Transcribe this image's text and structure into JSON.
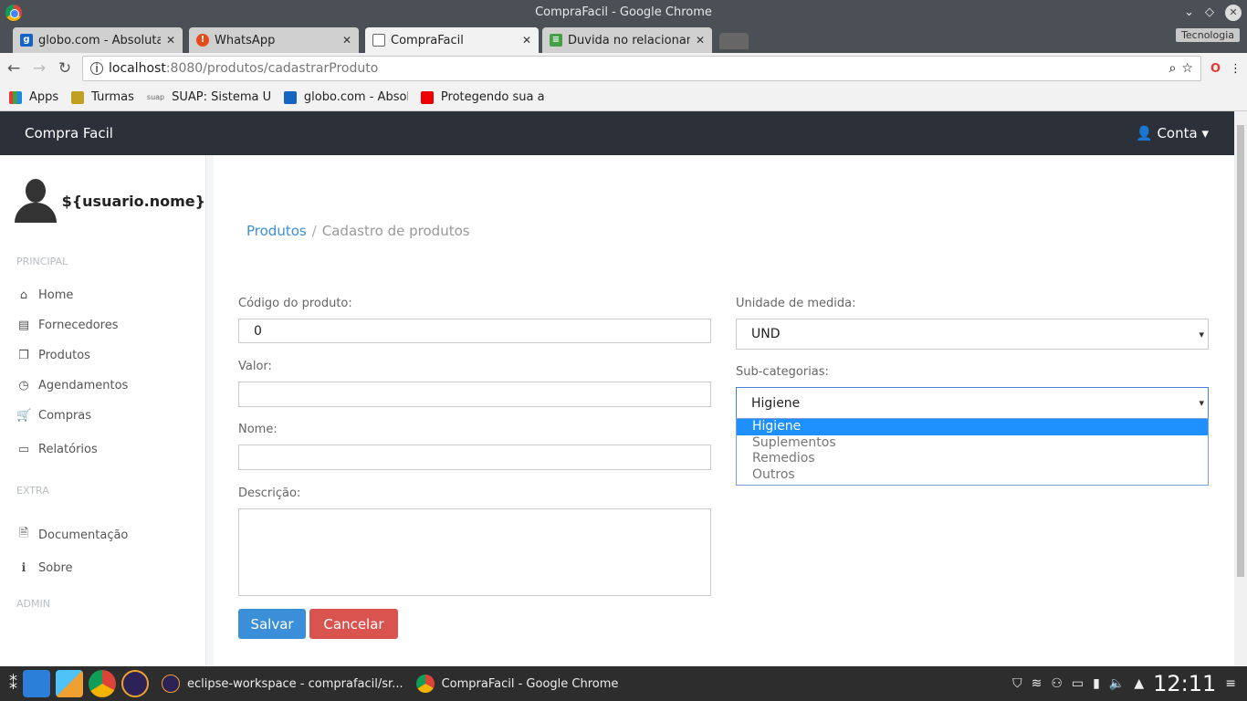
{
  "window": {
    "title": "CompraFacil - Google Chrome"
  },
  "tabs": [
    {
      "label": "globo.com - Absolutamente tudo",
      "color": "#1565c0",
      "glyph": "g"
    },
    {
      "label": "WhatsApp",
      "color": "#e64a19",
      "glyph": "!"
    },
    {
      "label": "CompraFacil",
      "color": "#fff",
      "glyph": ""
    },
    {
      "label": "Duvida no relacionamento",
      "color": "#43a047",
      "glyph": "≡"
    }
  ],
  "profile": "Tecnologia",
  "url": {
    "host": "localhost",
    "path": ":8080/produtos/cadastrarProduto"
  },
  "bookmarks": [
    {
      "label": "Apps"
    },
    {
      "label": "Turmas"
    },
    {
      "label": "SUAP: Sistema Unificado"
    },
    {
      "label": "globo.com - Absolutamente"
    },
    {
      "label": "Protegendo sua ap"
    }
  ],
  "navbar": {
    "brand": "Compra Facil",
    "account": "Conta"
  },
  "sidebar": {
    "username": "${usuario.nome}",
    "sections": {
      "principal": "PRINCIPAL",
      "extra": "EXTRA",
      "admin": "ADMIN"
    },
    "items": [
      {
        "label": "Home",
        "icon": "home-icon"
      },
      {
        "label": "Fornecedores",
        "icon": "id-card-icon"
      },
      {
        "label": "Produtos",
        "icon": "cubes-icon"
      },
      {
        "label": "Agendamentos",
        "icon": "clock-icon"
      },
      {
        "label": "Compras",
        "icon": "cart-icon"
      },
      {
        "label": "Relatórios",
        "icon": "report-icon"
      },
      {
        "label": "Documentação",
        "icon": "pdf-icon"
      },
      {
        "label": "Sobre",
        "icon": "info-icon"
      }
    ]
  },
  "breadcrumb": {
    "link": "Produtos",
    "current": "Cadastro de produtos"
  },
  "form": {
    "codigo_label": "Código do produto:",
    "codigo_value": "0",
    "valor_label": "Valor:",
    "nome_label": "Nome:",
    "descricao_label": "Descrição:",
    "unidade_label": "Unidade de medida:",
    "unidade_value": "UND",
    "subcat_label": "Sub-categorias:",
    "subcat_value": "Higiene",
    "subcat_options": [
      "Higiene",
      "Suplementos",
      "Remedios",
      "Outros"
    ],
    "salvar": "Salvar",
    "cancelar": "Cancelar"
  },
  "taskbar": {
    "tasks": [
      "eclipse-workspace - comprafacil/sr...",
      "CompraFacil - Google Chrome"
    ],
    "clock": "12:11"
  }
}
